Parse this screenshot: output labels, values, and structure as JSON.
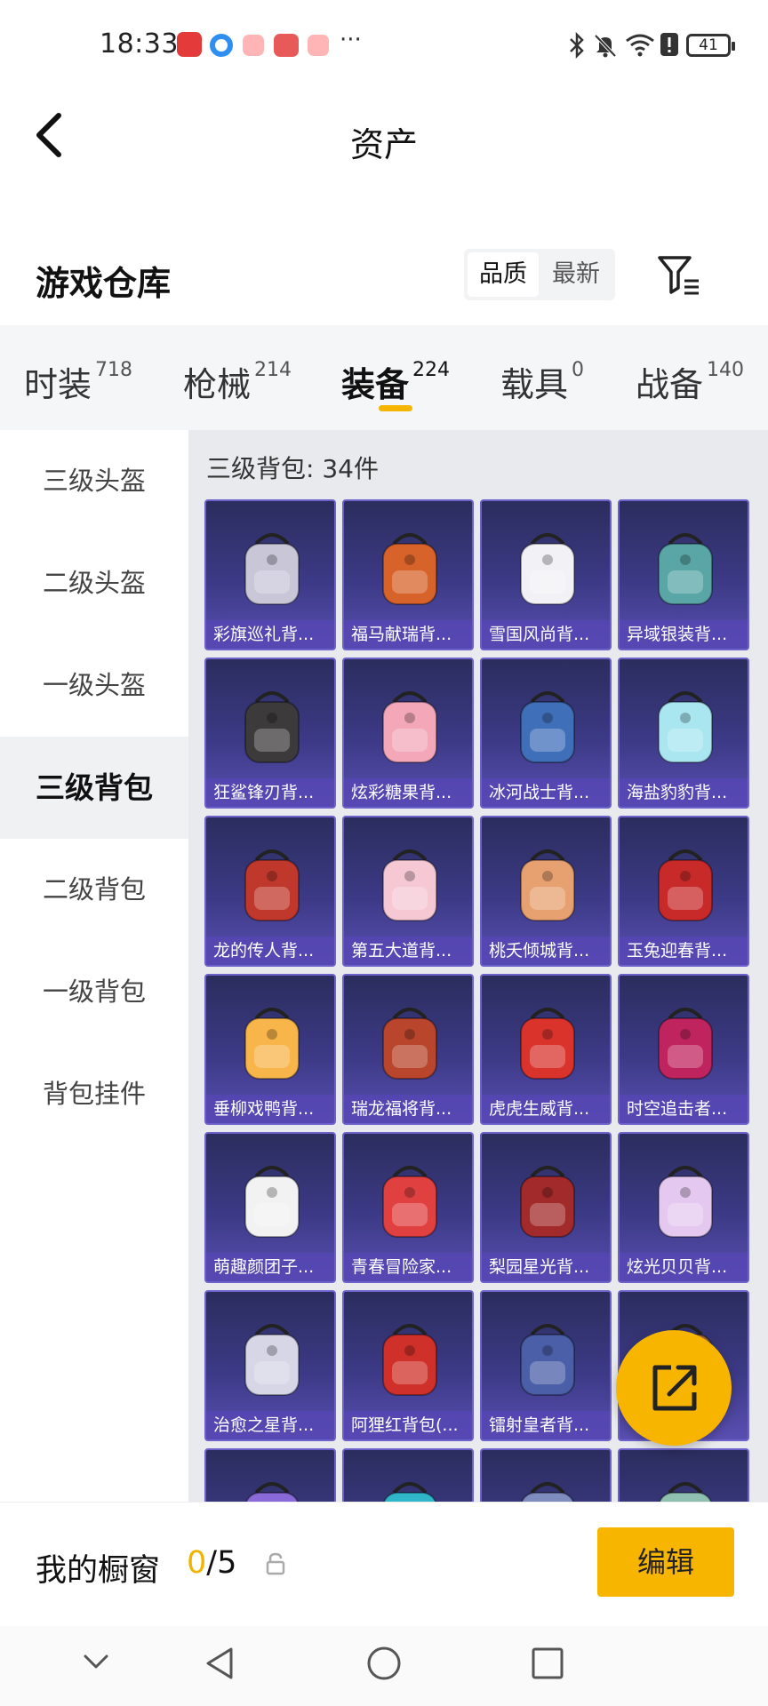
{
  "status_bar": {
    "time": "18:33",
    "more": "···",
    "battery": "41"
  },
  "header": {
    "title": "资产"
  },
  "warehouse": {
    "title": "游戏仓库",
    "sort_options": [
      "品质",
      "最新"
    ]
  },
  "tabs": [
    {
      "label": "时装",
      "count": "718"
    },
    {
      "label": "枪械",
      "count": "214"
    },
    {
      "label": "装备",
      "count": "224",
      "active": true
    },
    {
      "label": "载具",
      "count": "0"
    },
    {
      "label": "战备",
      "count": "140"
    }
  ],
  "sidebar": {
    "items": [
      {
        "label": "三级头盔"
      },
      {
        "label": "二级头盔"
      },
      {
        "label": "一级头盔"
      },
      {
        "label": "三级背包",
        "active": true
      },
      {
        "label": "二级背包"
      },
      {
        "label": "一级背包"
      },
      {
        "label": "背包挂件"
      }
    ]
  },
  "grid": {
    "title": "三级背包: 34件",
    "items": [
      {
        "name": "彩旗巡礼背...",
        "color": "#c9c6d8"
      },
      {
        "name": "福马献瑞背...",
        "color": "#d8632a"
      },
      {
        "name": "雪国风尚背...",
        "color": "#f2f2f6"
      },
      {
        "name": "异域银装背...",
        "color": "#5aa6a6"
      },
      {
        "name": "狂鲨锋刃背...",
        "color": "#3c3a3a"
      },
      {
        "name": "炫彩糖果背...",
        "color": "#f3a7b8"
      },
      {
        "name": "冰河战士背...",
        "color": "#3f6fb8"
      },
      {
        "name": "海盐豹豹背...",
        "color": "#a9e6f0"
      },
      {
        "name": "龙的传人背...",
        "color": "#c0382b"
      },
      {
        "name": "第五大道背...",
        "color": "#f6c8d4"
      },
      {
        "name": "桃夭倾城背...",
        "color": "#e7a070"
      },
      {
        "name": "玉兔迎春背...",
        "color": "#c82a2a"
      },
      {
        "name": "垂柳戏鸭背...",
        "color": "#f7b54a"
      },
      {
        "name": "瑞龙福将背...",
        "color": "#b8452c"
      },
      {
        "name": "虎虎生威背...",
        "color": "#d9332c"
      },
      {
        "name": "时空追击者...",
        "color": "#c0245e"
      },
      {
        "name": "萌趣颜团子...",
        "color": "#f2f2f2"
      },
      {
        "name": "青春冒险家...",
        "color": "#e04040"
      },
      {
        "name": "梨园星光背...",
        "color": "#a22a2a"
      },
      {
        "name": "炫光贝贝背...",
        "color": "#e4c8f0"
      },
      {
        "name": "治愈之星背...",
        "color": "#d6d6e6"
      },
      {
        "name": "阿狸红背包(...",
        "color": "#d0302a"
      },
      {
        "name": "镭射皇者背...",
        "color": "#4a5fa8"
      },
      {
        "name": "",
        "color": "#a86a3a"
      }
    ],
    "partial_row_colors": [
      "#8a6ad8",
      "#2fb6c8",
      "#7e8cc0",
      "#8fbfb0"
    ]
  },
  "bottom_bar": {
    "label": "我的橱窗",
    "used": "0",
    "total": "/5",
    "edit_label": "编辑"
  },
  "colors": {
    "accent": "#f7b500",
    "card_bg": "#3c3a86"
  }
}
